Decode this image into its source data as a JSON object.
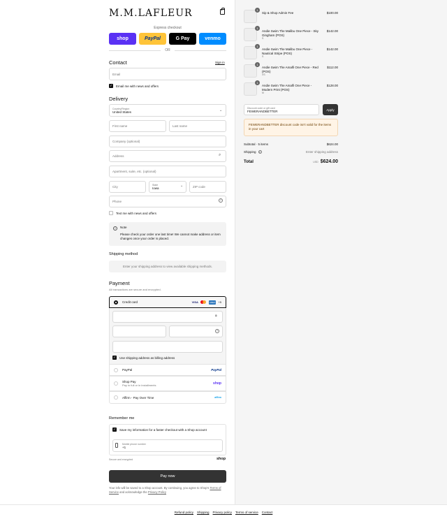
{
  "brand": {
    "logo": "M.M.LAFLEUR"
  },
  "express": {
    "label": "Express checkout",
    "buttons": [
      {
        "label": "shop",
        "bg": "#5a31f4",
        "fg": "#ffffff"
      },
      {
        "label": "PayPal",
        "bg": "#ffc439",
        "fg": "#003087"
      },
      {
        "label": "G Pay",
        "bg": "#000000",
        "fg": "#ffffff"
      },
      {
        "label": "venmo",
        "bg": "#008cff",
        "fg": "#ffffff"
      }
    ],
    "or": "OR"
  },
  "contact": {
    "title": "Contact",
    "sign_in": "Sign in",
    "email_placeholder": "Email",
    "email_news": "Email me with news and offers"
  },
  "delivery": {
    "title": "Delivery",
    "country_label": "Country/Region",
    "country_value": "United States",
    "first_name": "First name",
    "last_name": "Last name",
    "company": "Company (optional)",
    "address": "Address",
    "apartment": "Apartment, suite, etc. (optional)",
    "city": "City",
    "state_label": "State",
    "state_value": "Iowa",
    "zip": "ZIP code",
    "phone": "Phone",
    "text_news": "Text me with news and offers"
  },
  "note": {
    "title": "Note",
    "body": "Please check your order one last time! We cannot make address or item changes once your order is placed."
  },
  "shipping_method": {
    "title": "Shipping method",
    "placeholder": "Enter your shipping address to view available shipping methods."
  },
  "payment": {
    "title": "Payment",
    "subtitle": "All transactions are secure and encrypted.",
    "credit_card": "Credit card",
    "card_brands": [
      "VISA",
      "MC",
      "AMEX",
      "+5"
    ],
    "billing_same": "Use shipping address as billing address",
    "paypal": "PayPal",
    "paypal_logo": "PayPal",
    "shop_pay": "Shop Pay",
    "shop_pay_sub": "Pay in full or in installments",
    "shop_logo": "shop",
    "affirm": "Affirm - Pay Over Time",
    "affirm_logo": "affirm"
  },
  "remember": {
    "title": "Remember me",
    "save_info": "Save my information for a faster checkout with a Shop account",
    "mobile_label": "Mobile phone number",
    "mobile_value": "+1",
    "secure": "Secure and encrypted",
    "shop_logo": "shop"
  },
  "pay_now": "Pay now",
  "legal": {
    "text": "Your info will be saved to a Shop account. By continuing, you agree to Shop's",
    "terms": "Terms of Service",
    "and": "and acknowledge the",
    "privacy": "Privacy Policy"
  },
  "order": {
    "items": [
      {
        "qty": "1",
        "name": "Sip & Shop Admin Fee",
        "variant": "",
        "price": "$100.00"
      },
      {
        "qty": "1",
        "name": "Andie Swim The Malibu One Piece - Sky Gingham (POS)",
        "variant": "S",
        "price": "$142.00"
      },
      {
        "qty": "1",
        "name": "Andie Swim The Malibu One Piece - Nautical Stripe (POS)",
        "variant": "S",
        "price": "$142.00"
      },
      {
        "qty": "1",
        "name": "Andie Swim The Amalfi One Piece - Red (POS)",
        "variant": "XS",
        "price": "$112.00"
      },
      {
        "qty": "1",
        "name": "Andie Swim The Amalfi One Piece - Modern Print (POS)",
        "variant": "M",
        "price": "$128.00"
      }
    ],
    "discount_label": "Discount code or gift card",
    "discount_value": "FEWERANDBETTER",
    "apply": "Apply",
    "discount_error": "FEWERANDBETTER discount code isn't valid for the items in your cart",
    "subtotal_label": "Subtotal · 5 items",
    "subtotal_value": "$624.00",
    "shipping_label": "Shipping",
    "shipping_value": "Enter shipping address",
    "total_label": "Total",
    "currency": "USD",
    "total_value": "$624.00"
  },
  "footer": {
    "links": [
      "Refund policy",
      "Shipping",
      "Privacy policy",
      "Terms of service",
      "Contact"
    ]
  }
}
